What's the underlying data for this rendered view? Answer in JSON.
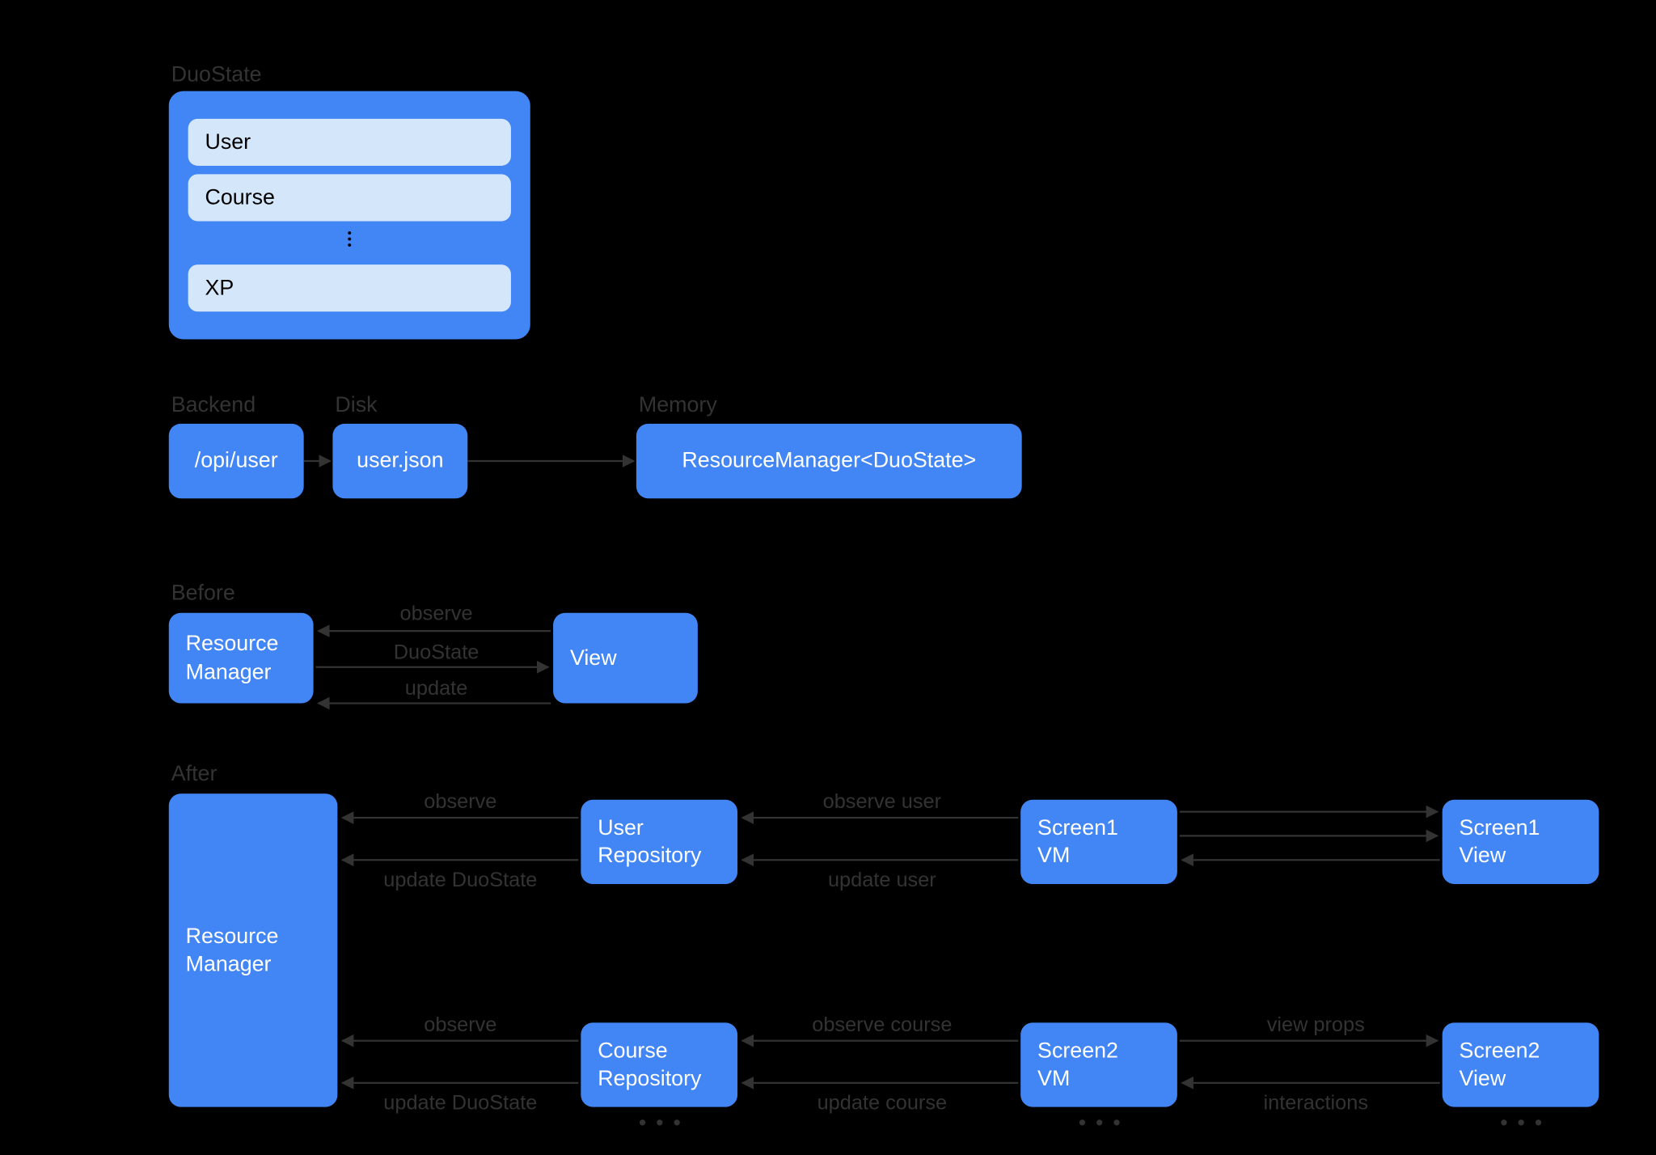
{
  "duostate": {
    "title": "DuoState",
    "items": [
      "User",
      "Course",
      "XP"
    ]
  },
  "flow": {
    "backend": {
      "label": "Backend",
      "box": "/opi/user"
    },
    "disk": {
      "label": "Disk",
      "box": "user.json"
    },
    "memory": {
      "label": "Memory",
      "box": "ResourceManager<DuoState>"
    }
  },
  "before": {
    "label": "Before",
    "rm": "Resource\nManager",
    "view": "View",
    "arrows": {
      "observe": "observe",
      "duostate": "DuoState",
      "update": "update"
    }
  },
  "after": {
    "label": "After",
    "rm": "Resource\nManager",
    "row1": {
      "repo": "User\nRepository",
      "vm": "Screen1\nVM",
      "view": "Screen1\nView",
      "a1": "observe",
      "a2": "update DuoState",
      "a3": "observe user",
      "a4": "update user"
    },
    "row2": {
      "repo": "Course\nRepository",
      "vm": "Screen2\nVM",
      "view": "Screen2\nView",
      "a1": "observe",
      "a2": "update DuoState",
      "a3": "observe course",
      "a4": "update course",
      "a5": "view props",
      "a6": "interactions"
    }
  },
  "colors": {
    "primary": "#4285f4",
    "light": "#d4e6fa"
  }
}
